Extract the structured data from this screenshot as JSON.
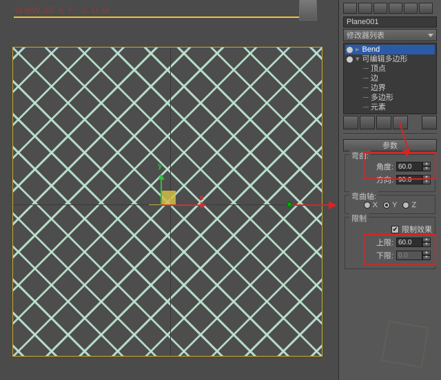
{
  "watermark": "WWW.3D X Y . C O M",
  "objectName": "Plane001",
  "modifierListLabel": "修改器列表",
  "stack": {
    "bend": "Bend",
    "editablePoly": "可编辑多边形",
    "subs": [
      "顶点",
      "边",
      "边界",
      "多边形",
      "元素"
    ]
  },
  "rollout": {
    "title": "参数",
    "bendGroup": {
      "legend": "弯曲:",
      "angleLabel": "角度:",
      "angleValue": "60.0",
      "dirLabel": "方向:",
      "dirValue": "90.0"
    },
    "axisGroup": {
      "legend": "弯曲轴:",
      "options": [
        "X",
        "Y",
        "Z"
      ],
      "selected": "Y"
    },
    "limitGroup": {
      "legend": "限制",
      "limitEffectLabel": "限制效果",
      "limitEffectChecked": true,
      "upperLabel": "上限:",
      "upperValue": "60.0",
      "lowerLabel": "下限:",
      "lowerValue": "0.0"
    }
  },
  "axisLabels": {
    "x": "x",
    "y": "y"
  }
}
